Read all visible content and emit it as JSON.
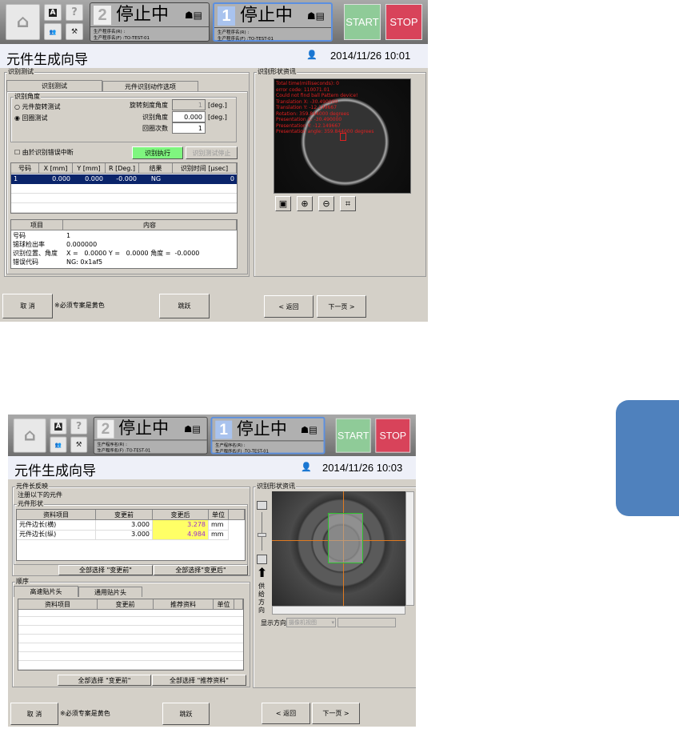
{
  "header": {
    "home_icon": "home-icon",
    "a_label": "A",
    "help_label": "?",
    "line2": {
      "num": "2",
      "status": "停止中",
      "prog_r": "生产程序名(R) :",
      "prog_f": "生产程序名(F) :TO-TEST-01"
    },
    "line1": {
      "num": "1",
      "status": "停止中",
      "prog_r": "生产程序名(R) :",
      "prog_f": "生产程序名(F) :TO-TEST-01"
    },
    "start": "START",
    "stop": "STOP",
    "start_color": "#8fcb98",
    "stop_color": "#d8435a"
  },
  "screen1": {
    "title": "元件生成向导",
    "datetime": "2014/11/26 10:01",
    "group_label": "识别测试",
    "tabs": [
      "识别测试",
      "元件识别动作选项"
    ],
    "angle_group": "识别角度",
    "radio_rotate": "元件旋转测试",
    "radio_loop": "回圈测试",
    "rot_step_label": "旋转刻度角度",
    "rot_step_value": "1",
    "angle_label": "识别角度",
    "angle_value": "0.000",
    "loop_label": "回圈次数",
    "loop_value": "1",
    "deg": "[deg.]",
    "stop_on_error": "由於识别错误中断",
    "exec_btn": "识别执行",
    "stop_btn": "识别测试停止",
    "result_cols": [
      "号码",
      "X [mm]",
      "Y [mm]",
      "R [Deg.]",
      "结果",
      "识别时间 [µsec]"
    ],
    "result_row": [
      "1",
      "0.000",
      "0.000",
      "-0.000",
      "NG",
      "0"
    ],
    "detail_cols": [
      "项目",
      "内容"
    ],
    "details": [
      [
        "号码",
        "1"
      ],
      [
        "锡球检出率",
        "0.000000"
      ],
      [
        "识别位置、角度",
        "X =   0.0000 Y =   0.0000 角度 =  -0.0000"
      ],
      [
        "错误代码",
        "NG: 0x1af5"
      ]
    ],
    "shape_group": "识别形状资讯",
    "overlay": [
      "Total time(milliseconds): 0",
      "error code: 110071.01",
      "Could not find ball Pattern device!",
      "Translation X: -30.490000",
      "Translation Y: -12.149667",
      "Rotation: 359.844000 degrees",
      "Presentation X: -30.490000",
      "Presentation Y: -12.149667",
      "Presentation angle: 359.844000 degrees"
    ],
    "cancel": "取 消",
    "note": "※必须专案是黄色",
    "skip": "跳跃",
    "back": "< 返回",
    "next": "下一页 >"
  },
  "screen2": {
    "title": "元件生成向导",
    "datetime": "2014/11/26 10:03",
    "group_label": "元件长反映",
    "register_text": "注册以下的元件",
    "shape_group": "元件形状",
    "shape_cols": [
      "资料项目",
      "变更前",
      "变更后",
      "单位"
    ],
    "shape_rows": [
      [
        "元件边长(横)",
        "3.000",
        "3.278",
        "mm"
      ],
      [
        "元件边长(纵)",
        "3.000",
        "4.984",
        "mm"
      ]
    ],
    "sel_before": "全部选择 \"变更前\"",
    "sel_after": "全部选择\"变更后\"",
    "order_group": "顺序",
    "tabs": [
      "高速贴片头",
      "通用贴片头"
    ],
    "order_cols": [
      "资料项目",
      "变更前",
      "推荐资料",
      "单位"
    ],
    "sel_before2": "全部选择 \"变更前\"",
    "sel_rec": "全部选择 \"推荐资料\"",
    "info_group": "识别形状资讯",
    "feed_dir": "供给方向",
    "display_dir": "显示方向",
    "display_value": "摄像机视图",
    "cancel": "取 消",
    "note": "※必须专案是黄色",
    "skip": "跳跃",
    "back": "< 返回",
    "next": "下一页 >",
    "highlight_color": "#ffff66"
  },
  "side_tab_color": "#4f81bd"
}
